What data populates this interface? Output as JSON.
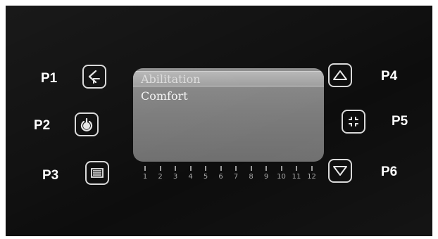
{
  "buttons": [
    {
      "id": "P1",
      "label": "P1",
      "icon": "back-arrow-icon"
    },
    {
      "id": "P2",
      "label": "P2",
      "icon": "power-icon"
    },
    {
      "id": "P3",
      "label": "P3",
      "icon": "menu-icon"
    },
    {
      "id": "P4",
      "label": "P4",
      "icon": "triangle-up-icon"
    },
    {
      "id": "P5",
      "label": "P5",
      "icon": "fullscreen-icon"
    },
    {
      "id": "P6",
      "label": "P6",
      "icon": "triangle-down-icon"
    }
  ],
  "display": {
    "menu": [
      {
        "label": "Abilitation",
        "selected": true
      },
      {
        "label": "Comfort",
        "selected": false
      }
    ]
  },
  "scale": [
    "1",
    "2",
    "3",
    "4",
    "5",
    "6",
    "7",
    "8",
    "9",
    "10",
    "11",
    "12"
  ],
  "colors": {
    "panel": "#0d0d0d",
    "screen": "#7f7f7f",
    "button_outline": "#d9d9d9"
  }
}
